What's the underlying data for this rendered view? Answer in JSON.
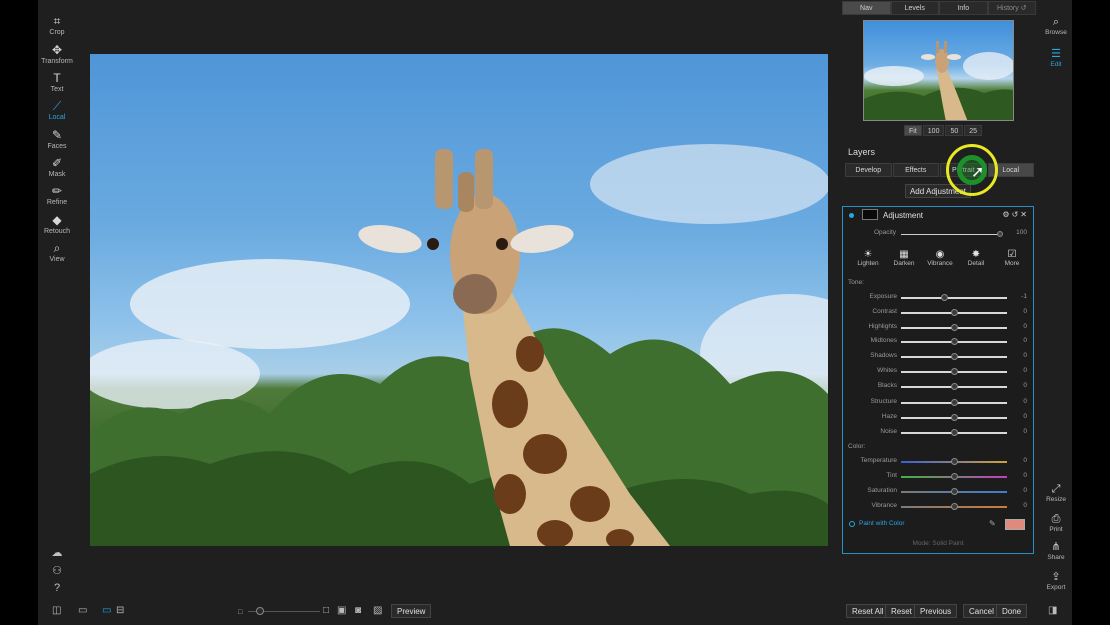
{
  "tools": [
    {
      "label": "Crop",
      "icon": "crop-icon",
      "glyph": "⌗"
    },
    {
      "label": "Transform",
      "icon": "move-icon",
      "glyph": "✥"
    },
    {
      "label": "Text",
      "icon": "text-icon",
      "glyph": "T"
    },
    {
      "label": "Local",
      "icon": "brush-icon",
      "glyph": "⟋"
    },
    {
      "label": "Faces",
      "icon": "face-brush-icon",
      "glyph": "✎"
    },
    {
      "label": "Mask",
      "icon": "mask-brush-icon",
      "glyph": "✐"
    },
    {
      "label": "Refine",
      "icon": "refine-brush-icon",
      "glyph": "✏"
    },
    {
      "label": "Retouch",
      "icon": "retouch-icon",
      "glyph": "◆"
    },
    {
      "label": "View",
      "icon": "zoom-view-icon",
      "glyph": "⌕"
    }
  ],
  "active_tool": "Local",
  "nav_tabs": [
    "Nav",
    "Levels",
    "Info",
    "History ↺"
  ],
  "zoom_buttons": [
    "Fit",
    "100",
    "50",
    "25"
  ],
  "layers": {
    "title": "Layers",
    "tabs": [
      "Develop",
      "Effects",
      "Portrait",
      "Local"
    ],
    "add_button": "Add Adjustment"
  },
  "adjustment": {
    "title": "Adjustment",
    "opacity_label": "Opacity",
    "opacity_value": "100",
    "presets": [
      {
        "label": "Lighten",
        "glyph": "☀"
      },
      {
        "label": "Darken",
        "glyph": "▦"
      },
      {
        "label": "Vibrance",
        "glyph": "◉"
      },
      {
        "label": "Detail",
        "glyph": "✸"
      },
      {
        "label": "More",
        "glyph": "☑"
      }
    ],
    "tone_label": "Tone:",
    "tone": [
      {
        "label": "Exposure",
        "value": "-1",
        "pos": 0.41
      },
      {
        "label": "Contrast",
        "value": "0",
        "pos": 0.5
      },
      {
        "label": "Highlights",
        "value": "0",
        "pos": 0.5
      },
      {
        "label": "Midtones",
        "value": "0",
        "pos": 0.5
      },
      {
        "label": "Shadows",
        "value": "0",
        "pos": 0.5
      },
      {
        "label": "Whites",
        "value": "0",
        "pos": 0.5
      },
      {
        "label": "Blacks",
        "value": "0",
        "pos": 0.5
      }
    ],
    "detail": [
      {
        "label": "Structure",
        "value": "0",
        "pos": 0.5
      },
      {
        "label": "Haze",
        "value": "0",
        "pos": 0.5
      },
      {
        "label": "Noise",
        "value": "0",
        "pos": 0.5
      }
    ],
    "color_label": "Color:",
    "color": [
      {
        "label": "Temperature",
        "value": "0",
        "pos": 0.5,
        "track": "linear-gradient(90deg,#3a5fd0,#d0a23a)"
      },
      {
        "label": "Tint",
        "value": "0",
        "pos": 0.5,
        "track": "linear-gradient(90deg,#3fb43f,#c23fc2)"
      },
      {
        "label": "Saturation",
        "value": "0",
        "pos": 0.5,
        "track": "linear-gradient(90deg,#7a7a7a,#3a7fd0)"
      },
      {
        "label": "Vibrance",
        "value": "0",
        "pos": 0.5,
        "track": "linear-gradient(90deg,#7a7a7a,#d07a3a)"
      }
    ],
    "paint_label": "Paint with Color",
    "paint_color": "#e08a7e",
    "mode_text": "Mode: Solid Paint"
  },
  "modules": [
    {
      "label": "Browse",
      "icon": "browse-icon",
      "glyph": "⌕"
    },
    {
      "label": "Edit",
      "icon": "edit-sliders-icon",
      "glyph": "☰"
    },
    {
      "label": "Resize",
      "icon": "resize-icon",
      "glyph": "⤢"
    },
    {
      "label": "Print",
      "icon": "print-icon",
      "glyph": "⎙"
    },
    {
      "label": "Share",
      "icon": "share-icon",
      "glyph": "⋔"
    },
    {
      "label": "Export",
      "icon": "export-icon",
      "glyph": "⇪"
    }
  ],
  "active_module": "Edit",
  "bottom": {
    "preview": "Preview",
    "reset_all": "Reset All",
    "reset": "Reset",
    "previous": "Previous",
    "cancel": "Cancel",
    "done": "Done"
  },
  "accent_color": "#2aa6e0"
}
